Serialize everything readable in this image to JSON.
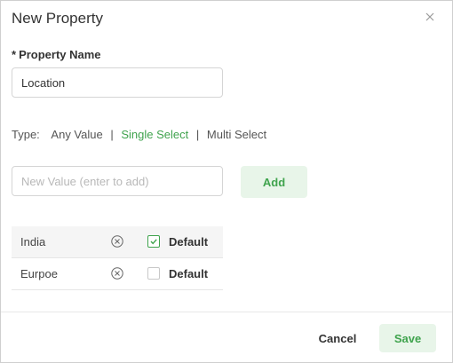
{
  "dialog": {
    "title": "New Property",
    "close_icon": "close-icon"
  },
  "property_name": {
    "required_marker": "*",
    "label": "Property Name",
    "value": "Location"
  },
  "type": {
    "label": "Type:",
    "options": [
      {
        "label": "Any Value",
        "active": false
      },
      {
        "label": "Single Select",
        "active": true
      },
      {
        "label": "Multi Select",
        "active": false
      }
    ],
    "separator": "|"
  },
  "new_value": {
    "value": "",
    "placeholder": "New Value (enter to add)",
    "add_label": "Add"
  },
  "values": [
    {
      "name": "India",
      "remove_icon": "circle-x-icon",
      "default_checked": true,
      "default_label": "Default"
    },
    {
      "name": "Eurpoe",
      "remove_icon": "circle-x-icon",
      "default_checked": false,
      "default_label": "Default"
    }
  ],
  "footer": {
    "cancel_label": "Cancel",
    "save_label": "Save"
  },
  "colors": {
    "accent": "#3fa34d",
    "accent_bg": "#e8f5e9"
  }
}
